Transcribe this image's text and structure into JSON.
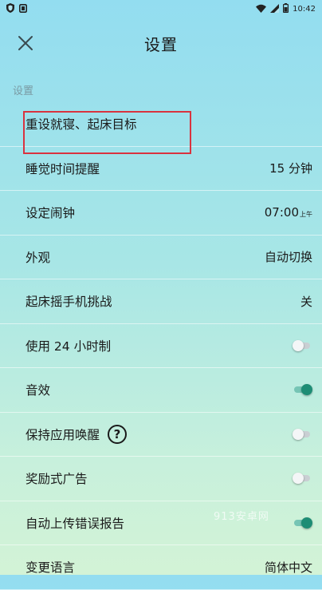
{
  "status_bar": {
    "time": "10:42",
    "left_icons": [
      "shield-icon",
      "sim-icon"
    ],
    "right_icons": [
      "wifi-icon",
      "signal-icon",
      "battery-icon"
    ]
  },
  "header": {
    "title": "设置",
    "close_icon": "close-icon"
  },
  "section_label": "设置",
  "rows": [
    {
      "label": "重设就寝、起床目标",
      "value": ""
    },
    {
      "label": "睡觉时间提醒",
      "value": "15 分钟"
    },
    {
      "label": "设定闹钟",
      "value": "07:00",
      "value_suffix": "上午"
    },
    {
      "label": "外观",
      "value": "自动切换"
    },
    {
      "label": "起床摇手机挑战",
      "value": "关"
    },
    {
      "label": "使用 24 小时制",
      "toggle": false
    },
    {
      "label": "音效",
      "toggle": true
    },
    {
      "label": "保持应用唤醒",
      "toggle": false,
      "help_icon": "?"
    },
    {
      "label": "奖励式广告",
      "toggle": false
    },
    {
      "label": "自动上传错误报告",
      "toggle": true
    },
    {
      "label": "变更语言",
      "value": "简体中文"
    }
  ],
  "highlight_color": "#d9333f",
  "accent_color": "#1e8d75",
  "watermark": "913安卓网"
}
